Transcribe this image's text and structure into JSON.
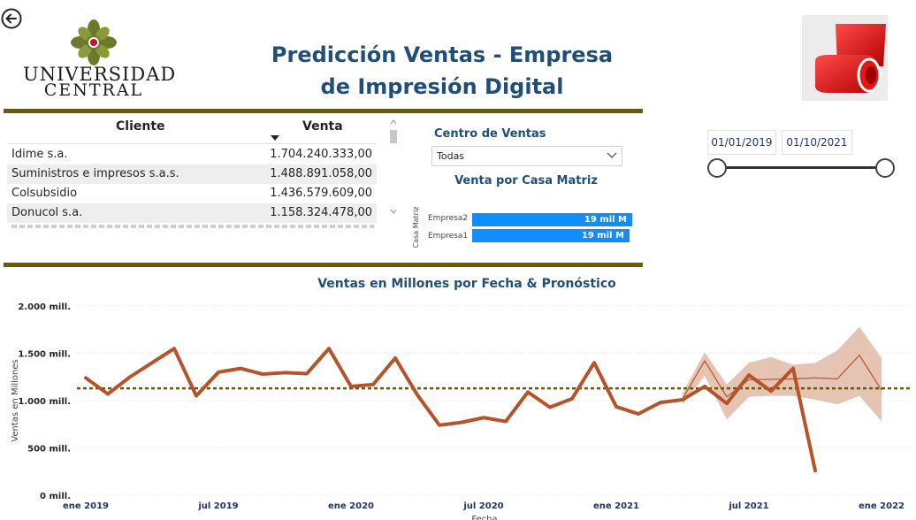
{
  "header": {
    "title": "Predicción Ventas - Empresa de Impresión Digital",
    "logo_line1": "UNIVERSIDAD",
    "logo_line2": "CENTRAL"
  },
  "table": {
    "columns": [
      "Cliente",
      "Venta"
    ],
    "rows": [
      {
        "cliente": "Idime s.a.",
        "venta": "1.704.240.333,00"
      },
      {
        "cliente": "Suministros e impresos s.a.s.",
        "venta": "1.488.891.058,00"
      },
      {
        "cliente": "Colsubsidio",
        "venta": "1.436.579.609,00"
      },
      {
        "cliente": "Donucol s.a.",
        "venta": "1.158.324.478,00"
      }
    ]
  },
  "slicer": {
    "title": "Centro de Ventas",
    "selected": "Todas"
  },
  "bar_chart": {
    "title": "Venta por Casa Matriz",
    "axis_label": "Casa Matriz",
    "bars": [
      {
        "label": "Empresa2",
        "value_label": "19 mil M",
        "fraction": 1.0
      },
      {
        "label": "Empresa1",
        "value_label": "19 mil M",
        "fraction": 0.985
      }
    ],
    "color": "#118dff"
  },
  "date_range": {
    "start": "01/01/2019",
    "end": "01/10/2021"
  },
  "chart_data": {
    "type": "line",
    "title": "Ventas en Millones por Fecha & Pronóstico",
    "xlabel": "Fecha",
    "ylabel": "Ventas en Millones",
    "y_ticks": [
      "0 mill.",
      "500 mill.",
      "1.000 mill.",
      "1.500 mill.",
      "2.000 mill."
    ],
    "x_ticks": [
      "ene 2019",
      "jul 2019",
      "ene 2020",
      "jul 2020",
      "ene 2021",
      "jul 2021",
      "ene 2022"
    ],
    "ylim": [
      0,
      2000
    ],
    "xlim": [
      "2019-01",
      "2022-01"
    ],
    "average_line": 1130,
    "series": [
      {
        "type": "actual",
        "color": "#b5532b",
        "x": [
          "2019-01",
          "2019-02",
          "2019-03",
          "2019-04",
          "2019-05",
          "2019-06",
          "2019-07",
          "2019-08",
          "2019-09",
          "2019-10",
          "2019-11",
          "2019-12",
          "2020-01",
          "2020-02",
          "2020-03",
          "2020-04",
          "2020-05",
          "2020-06",
          "2020-07",
          "2020-08",
          "2020-09",
          "2020-10",
          "2020-11",
          "2020-12",
          "2021-01",
          "2021-02",
          "2021-03",
          "2021-04",
          "2021-05",
          "2021-06",
          "2021-07",
          "2021-08",
          "2021-09",
          "2021-10"
        ],
        "values": [
          1240,
          1070,
          1250,
          1400,
          1550,
          1050,
          1300,
          1340,
          1280,
          1295,
          1285,
          1550,
          1150,
          1170,
          1450,
          1060,
          740,
          770,
          820,
          780,
          1090,
          930,
          1020,
          1400,
          935,
          860,
          980,
          1010,
          1150,
          970,
          1270,
          1100,
          1340,
          260
        ]
      },
      {
        "type": "forecast",
        "color": "#b5532b",
        "x": [
          "2021-04",
          "2021-05",
          "2021-06",
          "2021-07",
          "2021-08",
          "2021-09",
          "2021-10",
          "2021-11",
          "2021-12",
          "2022-01"
        ],
        "values": [
          1020,
          1420,
          1040,
          1220,
          1225,
          1230,
          1240,
          1230,
          1480,
          1110
        ],
        "upper": [
          1080,
          1510,
          1170,
          1400,
          1460,
          1380,
          1400,
          1530,
          1780,
          1450
        ],
        "lower": [
          960,
          1260,
          800,
          1040,
          1050,
          1050,
          1010,
          960,
          1050,
          780
        ]
      }
    ],
    "average_line_color": "#6b5a00"
  }
}
